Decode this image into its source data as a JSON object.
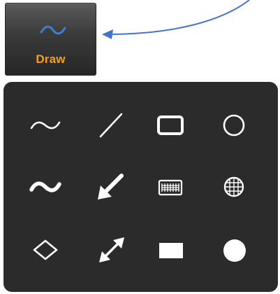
{
  "toolbar": {
    "draw_button": {
      "label": "Draw",
      "icon": "freehand-wave-icon",
      "label_color": "#f2a11a",
      "icon_color": "#3d7fd6"
    },
    "callout_arrow_color": "#4472c4"
  },
  "draw_menu": {
    "background": "#2b2b2b",
    "tools": [
      {
        "icon": "freehand-thin-icon"
      },
      {
        "icon": "line-icon"
      },
      {
        "icon": "rectangle-outline-icon"
      },
      {
        "icon": "ellipse-outline-icon"
      },
      {
        "icon": "freehand-thick-icon"
      },
      {
        "icon": "arrow-icon"
      },
      {
        "icon": "rectangle-grid-icon"
      },
      {
        "icon": "ellipse-grid-icon"
      },
      {
        "icon": "diamond-outline-icon"
      },
      {
        "icon": "double-arrow-icon"
      },
      {
        "icon": "rectangle-filled-icon"
      },
      {
        "icon": "ellipse-filled-icon"
      }
    ]
  }
}
